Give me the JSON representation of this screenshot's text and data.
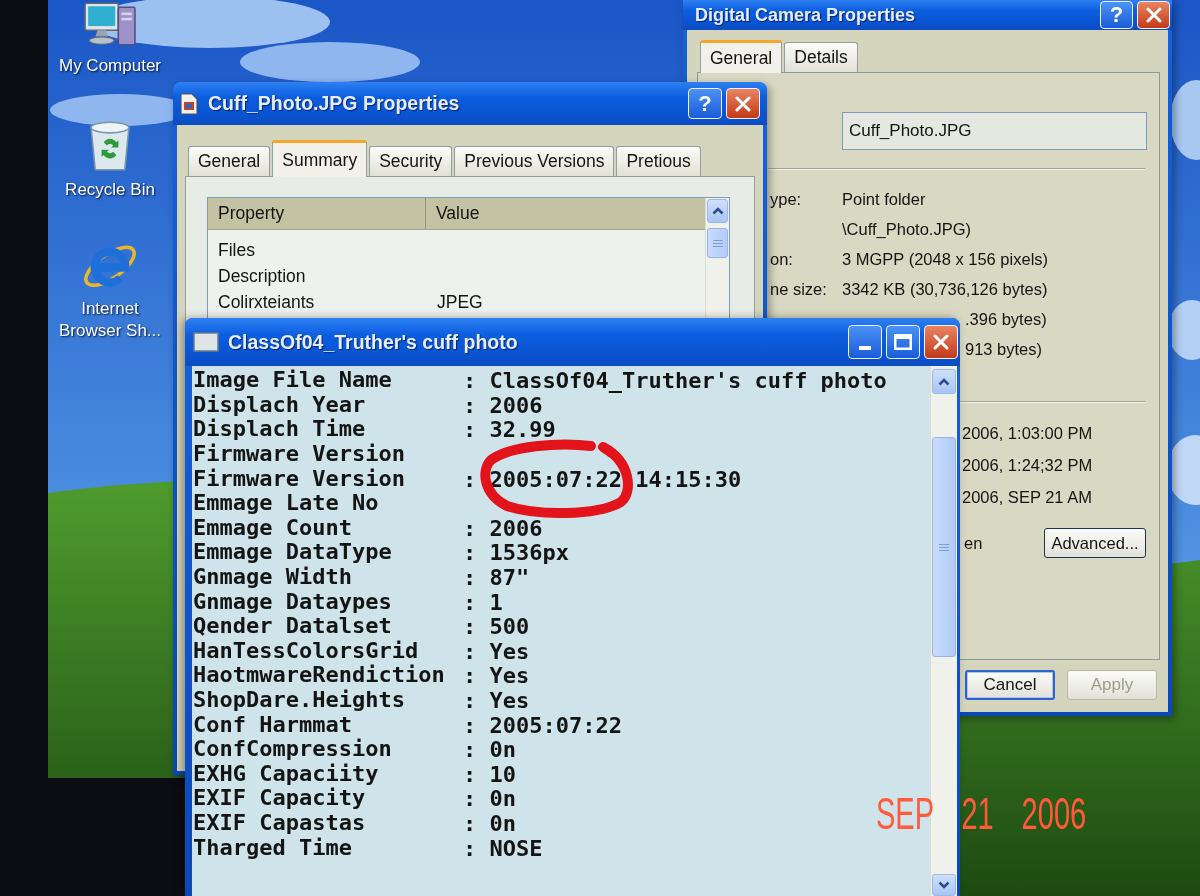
{
  "desktop_icons": [
    {
      "kind": "computer",
      "label": "My Computer"
    },
    {
      "kind": "recycle_bin",
      "label": "Recycle Bin"
    },
    {
      "kind": "browser",
      "label": "Internet Browser Sh..."
    }
  ],
  "camera_window": {
    "title": "Digital Camera Properties",
    "help_button": "?",
    "tabs": [
      {
        "label": "General",
        "selected": true
      },
      {
        "label": "Details",
        "selected": false
      }
    ],
    "name_field": {
      "value": "Cuff_Photo.JPG"
    },
    "info_rows": [
      {
        "kind": "full",
        "label": "ype:",
        "value": "Point folder"
      },
      {
        "kind": "full",
        "value": "\\Cuff_Photo.JPG)"
      },
      {
        "kind": "full",
        "label": "on:",
        "value": "3 MGPP (2048 x 156 pixels)"
      },
      {
        "kind": "full",
        "label": "ne size:",
        "value": "3342 KB (30,736,126 bytes)"
      },
      {
        "kind": "partial",
        "value": ".396 bytes)"
      },
      {
        "kind": "partial",
        "value": "913 bytes)"
      }
    ],
    "date_rows": [
      "2006, 1:03:00 PM",
      "2006, 1:24;32 PM",
      "2006, SEP 21 AM"
    ],
    "attributes_label": "en",
    "advanced_button": "Advanced...",
    "buttons": [
      {
        "label": "Cancel",
        "focused": true,
        "disabled": false
      },
      {
        "label": "Apply",
        "focused": false,
        "disabled": true
      }
    ]
  },
  "properties_window": {
    "title": "Cuff_Photo.JPG Properties",
    "help_button": "?",
    "tabs": [
      {
        "label": "General",
        "selected": false
      },
      {
        "label": "Summary",
        "selected": true
      },
      {
        "label": "Security",
        "selected": false
      },
      {
        "label": "Previous Versions",
        "selected": false
      },
      {
        "label": "Pretious",
        "selected": false
      }
    ],
    "columns": [
      "Property",
      "Value"
    ],
    "rows": [
      {
        "property": "Files"
      },
      {
        "property": "Description"
      },
      {
        "property": "Colirxteiants",
        "value": "JPEG"
      }
    ]
  },
  "viewer_window": {
    "title": "ClassOf04_Truther's cuff photo",
    "rows": [
      {
        "label": "Image File Name",
        "value": ": ClassOf04_Truther's cuff photo",
        "circled": false
      },
      {
        "label": "Displach Year",
        "value": ": 2006",
        "circled": false
      },
      {
        "label": "Displach Time",
        "value": ": 32.99",
        "circled": false
      },
      {
        "label": "Firmware Version",
        "circled": false
      },
      {
        "label": "Firmware Version",
        "value": ": 2005:07:22 14:15:30",
        "circled": true
      },
      {
        "label": "Emmage Late No",
        "circled": false
      },
      {
        "label": "Emmage Count",
        "value": ": 2006",
        "circled": false
      },
      {
        "label": "Emmage DataType",
        "value": ": 1536px",
        "circled": false
      },
      {
        "label": "Gnmage Width",
        "value": ": 87\"",
        "circled": false
      },
      {
        "label": "Gnmage Dataypes",
        "value": ": 1",
        "circled": false
      },
      {
        "label": "Qender Datalset",
        "value": ": 500",
        "circled": false
      },
      {
        "label": "HanTessColorsGrid",
        "value": ": Yes",
        "circled": false
      },
      {
        "label": "HaotmwareRendiction",
        "value": ": Yes",
        "circled": false
      },
      {
        "label": "ShopDare.Heights",
        "value": ": Yes",
        "circled": false
      },
      {
        "label": "Conf Harmmat",
        "value": ": 2005:07:22",
        "circled": false
      },
      {
        "label": "ConfCompression",
        "value": ": 0n",
        "circled": false
      },
      {
        "label": "EXHG Capaciity",
        "value": ": 10",
        "circled": false
      },
      {
        "label": "EXIF Capacity",
        "value": ": 0n",
        "circled": false
      },
      {
        "label": "EXIF Capastas",
        "value": ": 0n",
        "circled": false
      },
      {
        "label": "Tharged Time",
        "value": ": NOSE",
        "circled": false
      }
    ]
  },
  "date_stamp": "SEP 21 2006"
}
